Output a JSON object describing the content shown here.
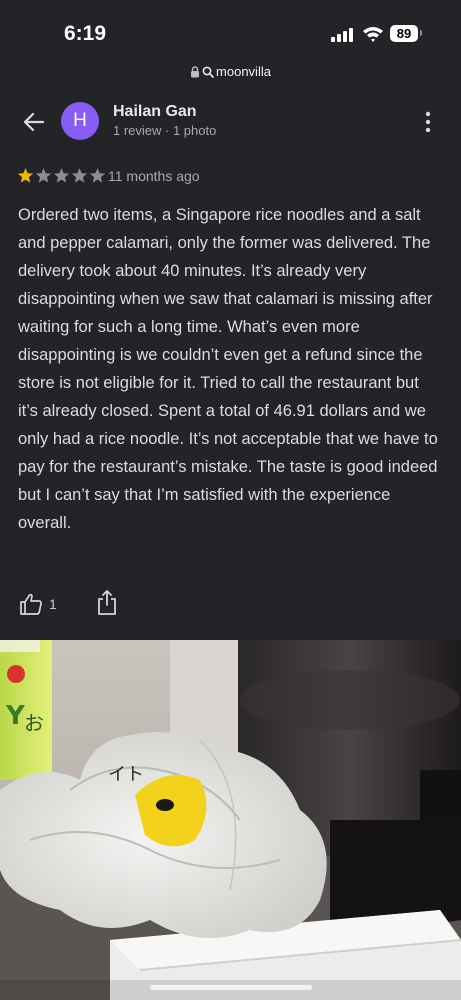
{
  "status_bar": {
    "time": "6:19",
    "battery": "89"
  },
  "url_bar": {
    "domain": "moonvilla"
  },
  "reviewer": {
    "avatar_initial": "H",
    "avatar_color": "#8a5cf6",
    "name": "Hailan Gan",
    "meta": "1 review · 1 photo"
  },
  "review": {
    "rating": 1,
    "max_rating": 5,
    "star_filled_color": "#f4b400",
    "star_empty_color": "#8e8e8e",
    "date": "11 months ago",
    "text": "Ordered two items, a Singapore rice noodles and a salt and pepper calamari, only the former was delivered. The delivery took about 40 minutes. It’s already very disappointing when we saw that calamari is missing after waiting for such a long time. What’s even more disappointing is we couldn’t even get a refund since the store is not eligible for it. Tried to call the restaurant but it’s already closed. Spent a total of 46.91 dollars and we only had a rice noodle. It’s not acceptable that we have to pay for the restaurant’s mistake. The taste is good indeed but I can’t say that I’m satisfied with the experience overall."
  },
  "actions": {
    "like_icon": "thumbs-up-icon",
    "like_count": "1",
    "share_icon": "share-icon"
  },
  "photo": {
    "packaging_label": "イト"
  },
  "icons": {
    "back": "arrow-left-icon",
    "more": "more-vertical-icon",
    "lock": "lock-icon",
    "search": "search-icon"
  }
}
